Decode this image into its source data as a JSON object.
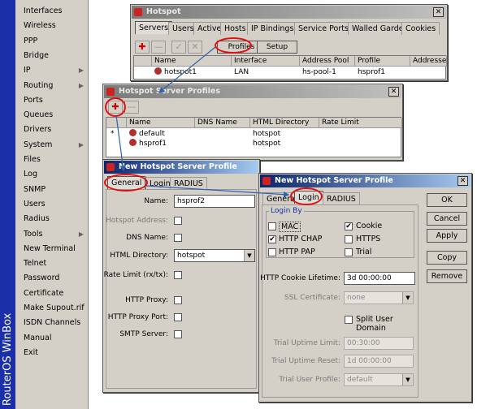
{
  "brand": "RouterOS WinBox",
  "menu": [
    {
      "label": "Interfaces",
      "arrow": false
    },
    {
      "label": "Wireless",
      "arrow": false
    },
    {
      "label": "PPP",
      "arrow": false
    },
    {
      "label": "Bridge",
      "arrow": false
    },
    {
      "label": "IP",
      "arrow": true
    },
    {
      "label": "Routing",
      "arrow": true
    },
    {
      "label": "Ports",
      "arrow": false
    },
    {
      "label": "Queues",
      "arrow": false
    },
    {
      "label": "Drivers",
      "arrow": false
    },
    {
      "label": "System",
      "arrow": true
    },
    {
      "label": "Files",
      "arrow": false
    },
    {
      "label": "Log",
      "arrow": false
    },
    {
      "label": "SNMP",
      "arrow": false
    },
    {
      "label": "Users",
      "arrow": false
    },
    {
      "label": "Radius",
      "arrow": false
    },
    {
      "label": "Tools",
      "arrow": true
    },
    {
      "label": "New Terminal",
      "arrow": false
    },
    {
      "label": "Telnet",
      "arrow": false
    },
    {
      "label": "Password",
      "arrow": false
    },
    {
      "label": "Certificate",
      "arrow": false
    },
    {
      "label": "Make Supout.rif",
      "arrow": false
    },
    {
      "label": "ISDN Channels",
      "arrow": false
    },
    {
      "label": "Manual",
      "arrow": false
    },
    {
      "label": "Exit",
      "arrow": false
    }
  ],
  "hotspot": {
    "title": "Hotspot",
    "tabs": [
      "Servers",
      "Users",
      "Active",
      "Hosts",
      "IP Bindings",
      "Service Ports",
      "Walled Garden",
      "Cookies"
    ],
    "profiles_btn": "Profiles",
    "setup_btn": "Setup",
    "columns": [
      "Name",
      "Interface",
      "Address Pool",
      "Profile",
      "Addresses"
    ],
    "rows": [
      [
        "hotspot1",
        "LAN",
        "hs-pool-1",
        "hsprof1",
        ""
      ]
    ]
  },
  "profiles": {
    "title": "Hotspot Server Profiles",
    "columns": [
      "Name",
      "DNS Name",
      "HTML Directory",
      "Rate Limit"
    ],
    "rows": [
      {
        "marker": "*",
        "name": "default",
        "dns": "",
        "html": "hotspot",
        "rate": ""
      },
      {
        "marker": "",
        "name": "hsprof1",
        "dns": "",
        "html": "hotspot",
        "rate": ""
      }
    ]
  },
  "newprof1": {
    "title": "New Hotspot Server Profile",
    "tabs": [
      "General",
      "Login",
      "RADIUS"
    ],
    "fields": {
      "name_label": "Name:",
      "name_value": "hsprof2",
      "hotspot_address_label": "Hotspot Address:",
      "dns_name_label": "DNS Name:",
      "html_dir_label": "HTML Directory:",
      "html_dir_value": "hotspot",
      "rate_limit_label": "Rate Limit (rx/tx):",
      "http_proxy_label": "HTTP Proxy:",
      "http_proxy_port_label": "HTTP Proxy Port:",
      "smtp_server_label": "SMTP Server:"
    }
  },
  "newprof2": {
    "title": "New Hotspot Server Profile",
    "tabs": [
      "General",
      "Login",
      "RADIUS"
    ],
    "login_by_label": "Login By",
    "checks": {
      "mac": {
        "label": "MAC",
        "checked": false
      },
      "cookie": {
        "label": "Cookie",
        "checked": true
      },
      "http_chap": {
        "label": "HTTP CHAP",
        "checked": true
      },
      "https": {
        "label": "HTTPS",
        "checked": false
      },
      "http_pap": {
        "label": "HTTP PAP",
        "checked": false
      },
      "trial": {
        "label": "Trial",
        "checked": false
      }
    },
    "cookie_lifetime_label": "HTTP Cookie Lifetime:",
    "cookie_lifetime_value": "3d 00:00:00",
    "ssl_label": "SSL Certificate:",
    "ssl_value": "none",
    "split_label": "Split User Domain",
    "trial_uptime_limit_label": "Trial Uptime Limit:",
    "trial_uptime_limit_value": "00:30:00",
    "trial_uptime_reset_label": "Trial Uptime Reset:",
    "trial_uptime_reset_value": "1d 00:00:00",
    "trial_user_profile_label": "Trial User Profile:",
    "trial_user_profile_value": "default",
    "buttons": {
      "ok": "OK",
      "cancel": "Cancel",
      "apply": "Apply",
      "copy": "Copy",
      "remove": "Remove"
    }
  },
  "colors": {
    "brand_bar": "#1a2fa8",
    "title_active": "#0a246a",
    "highlight_ring": "#e01010",
    "arrow": "#3060b0"
  }
}
